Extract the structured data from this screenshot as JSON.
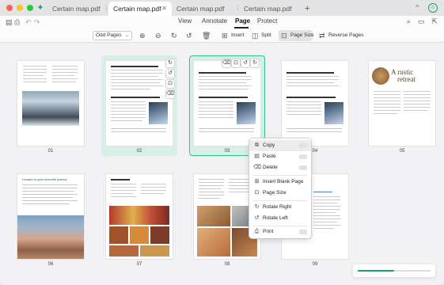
{
  "tabs": [
    {
      "label": "Certain map.pdf",
      "active": false
    },
    {
      "label": "Certain map.pdf",
      "active": true
    },
    {
      "label": "Certain map.pdf",
      "active": false
    },
    {
      "label": "Certain map.pdf",
      "active": false
    }
  ],
  "menu": {
    "items": [
      "View",
      "Annotate",
      "Page",
      "Protect"
    ],
    "active": "Page"
  },
  "toolbar": {
    "page_filter": "Odd Pages",
    "insert_label": "Insert",
    "split_label": "Split",
    "page_size_label": "Page Size",
    "reverse_label": "Reverse Pages"
  },
  "pages": [
    {
      "number": "01"
    },
    {
      "number": "02"
    },
    {
      "number": "03"
    },
    {
      "number": "04"
    },
    {
      "number": "05"
    },
    {
      "number": "06"
    },
    {
      "number": "07"
    },
    {
      "number": "08"
    },
    {
      "number": "09"
    }
  ],
  "page_text": {
    "p5_title_line1": "A rustic",
    "p5_title_line2": "retreat",
    "p6_heading": "Located on your favourite journey"
  },
  "context_menu": [
    {
      "label": "Copy",
      "icon": "copy-icon"
    },
    {
      "label": "Paste",
      "icon": "paste-icon"
    },
    {
      "label": "Delete",
      "icon": "trash-icon"
    },
    {
      "label": "Insert Blank Page",
      "icon": "insert-page-icon"
    },
    {
      "label": "Page Size",
      "icon": "page-size-icon"
    },
    {
      "label": "Rotate Right",
      "icon": "rotate-right-icon"
    },
    {
      "label": "Rotate Left",
      "icon": "rotate-left-icon"
    },
    {
      "label": "Print",
      "icon": "print-icon"
    }
  ],
  "progress": {
    "value": 0.5
  },
  "colors": {
    "accent": "#1aa06d",
    "selection_bg": "#d7efe5",
    "selection_border": "#36c394"
  }
}
